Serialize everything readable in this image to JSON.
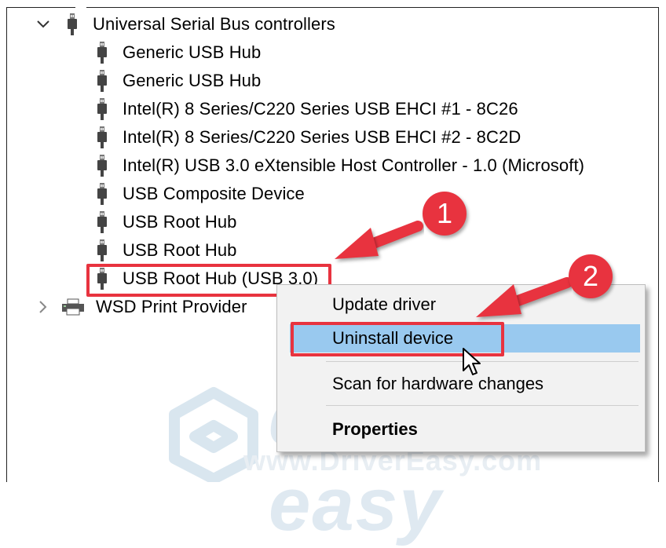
{
  "tree": {
    "category": {
      "label": "Universal Serial Bus controllers",
      "expanded": true
    },
    "devices": [
      {
        "label": "Generic USB Hub"
      },
      {
        "label": "Generic USB Hub"
      },
      {
        "label": "Intel(R) 8 Series/C220 Series USB EHCI #1 - 8C26"
      },
      {
        "label": "Intel(R) 8 Series/C220 Series USB EHCI #2 - 8C2D"
      },
      {
        "label": "Intel(R) USB 3.0 eXtensible Host Controller - 1.0 (Microsoft)"
      },
      {
        "label": "USB Composite Device"
      },
      {
        "label": "USB Root Hub"
      },
      {
        "label": "USB Root Hub"
      },
      {
        "label": "USB Root Hub (USB 3.0)",
        "selected": true
      }
    ],
    "next_category": {
      "label": "WSD Print Provider",
      "expanded": false
    }
  },
  "context_menu": {
    "items": [
      {
        "label": "Update driver"
      },
      {
        "label": "Uninstall device",
        "highlighted": true
      },
      {
        "label": "Scan for hardware changes"
      },
      {
        "label": "Properties",
        "bold": true
      }
    ]
  },
  "annotations": {
    "step1": "1",
    "step2": "2",
    "accent_color": "#e8333f"
  },
  "watermark": {
    "brand": "driver easy",
    "url": "www.DriverEasy.com"
  },
  "icons": {
    "expand": "chevron-down-icon",
    "collapse": "chevron-right-icon",
    "usb": "usb-connector-icon",
    "printer": "printer-icon",
    "cursor": "mouse-pointer-icon"
  }
}
